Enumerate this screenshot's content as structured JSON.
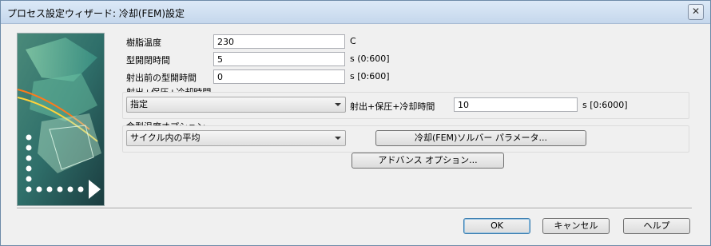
{
  "window": {
    "title": "プロセス設定ウィザード: 冷却(FEM)設定",
    "close_label": "✕"
  },
  "form": {
    "resin_temp": {
      "label": "樹脂温度",
      "value": "230",
      "unit": "C"
    },
    "mold_open_time": {
      "label": "型開閉時間",
      "value": "5",
      "unit": "s (0:600]"
    },
    "pre_injection_open_time": {
      "label": "射出前の型開時間",
      "value": "0",
      "unit": "s [0:600]"
    }
  },
  "injection_group": {
    "title": "射出+保圧+冷却時間",
    "mode_selected": "指定",
    "time_label": "射出+保圧+冷却時間",
    "time_value": "10",
    "time_unit": "s [0:6000]"
  },
  "mold_temp_group": {
    "title": "金型温度オプション",
    "option_selected": "サイクル内の平均",
    "solver_button": "冷却(FEM)ソルバー パラメータ..."
  },
  "advanced_button": "アドバンス オプション...",
  "footer": {
    "ok": "OK",
    "cancel": "キャンセル",
    "help": "ヘルプ"
  }
}
